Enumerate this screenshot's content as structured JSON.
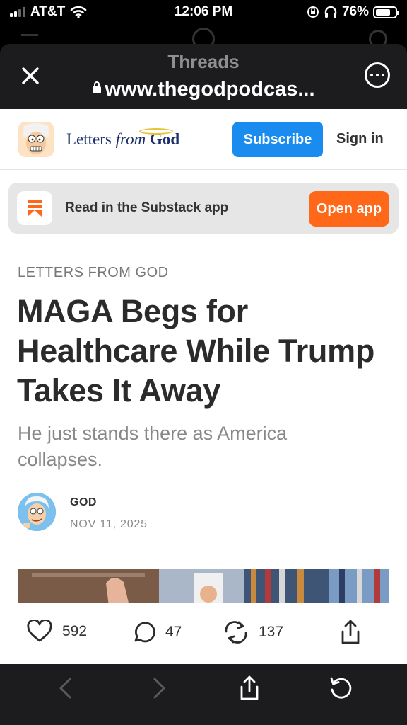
{
  "status_bar": {
    "carrier": "AT&T",
    "time": "12:06 PM",
    "battery_percent": "76%",
    "battery_level": 0.76
  },
  "browser": {
    "title": "Threads",
    "url": "www.thegodpodcas..."
  },
  "site": {
    "name_part1": "Letters",
    "name_part2": "from",
    "name_part3": "God",
    "subscribe_label": "Subscribe",
    "signin_label": "Sign in",
    "accent_color": "#1a8cf0"
  },
  "app_banner": {
    "text": "Read in the Substack app",
    "button_label": "Open app",
    "button_color": "#ff6719"
  },
  "article": {
    "kicker": "LETTERS FROM GOD",
    "headline": "MAGA Begs for Healthcare While Trump Takes It Away",
    "subtitle": "He just stands there as America collapses.",
    "author": "GOD",
    "date": "NOV 11, 2025"
  },
  "actions": {
    "likes": "592",
    "comments": "47",
    "restacks": "137"
  },
  "icons": {
    "close": "close-icon",
    "more": "more-icon",
    "like": "heart-icon",
    "comment": "comment-icon",
    "restack": "restack-icon",
    "share": "share-icon",
    "back": "chevron-left-icon",
    "forward": "chevron-right-icon",
    "reload": "reload-icon"
  }
}
